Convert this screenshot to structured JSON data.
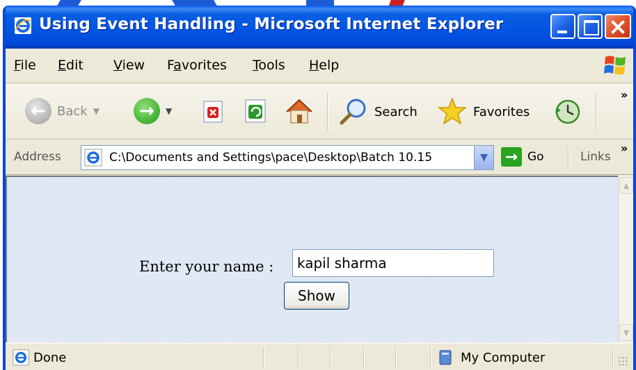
{
  "window": {
    "title": "Using Event Handling - Microsoft Internet Explorer"
  },
  "menu": {
    "items": [
      {
        "label": "File",
        "accel": "F",
        "rest": "ile"
      },
      {
        "label": "Edit",
        "accel": "E",
        "rest": "dit"
      },
      {
        "label": "View",
        "accel": "V",
        "rest": "iew"
      },
      {
        "label": "Favorites",
        "pre": "F",
        "accel": "a",
        "rest": "vorites"
      },
      {
        "label": "Tools",
        "accel": "T",
        "rest": "ools"
      },
      {
        "label": "Help",
        "accel": "H",
        "rest": "elp"
      }
    ]
  },
  "toolbar": {
    "back_label": "Back",
    "search_label": "Search",
    "favorites_label": "Favorites",
    "overflow": "»"
  },
  "address": {
    "label": "Address",
    "value": "C:\\Documents and Settings\\pace\\Desktop\\Batch 10.15",
    "go_label": "Go",
    "links_label": "Links",
    "overflow": "»"
  },
  "page": {
    "prompt_label": "Enter your name :",
    "name_value": "kapil sharma",
    "show_button": "Show"
  },
  "status": {
    "text": "Done",
    "zone": "My Computer"
  },
  "colors": {
    "titlebar": "#0054e3",
    "content_bg": "#dce6f4"
  }
}
